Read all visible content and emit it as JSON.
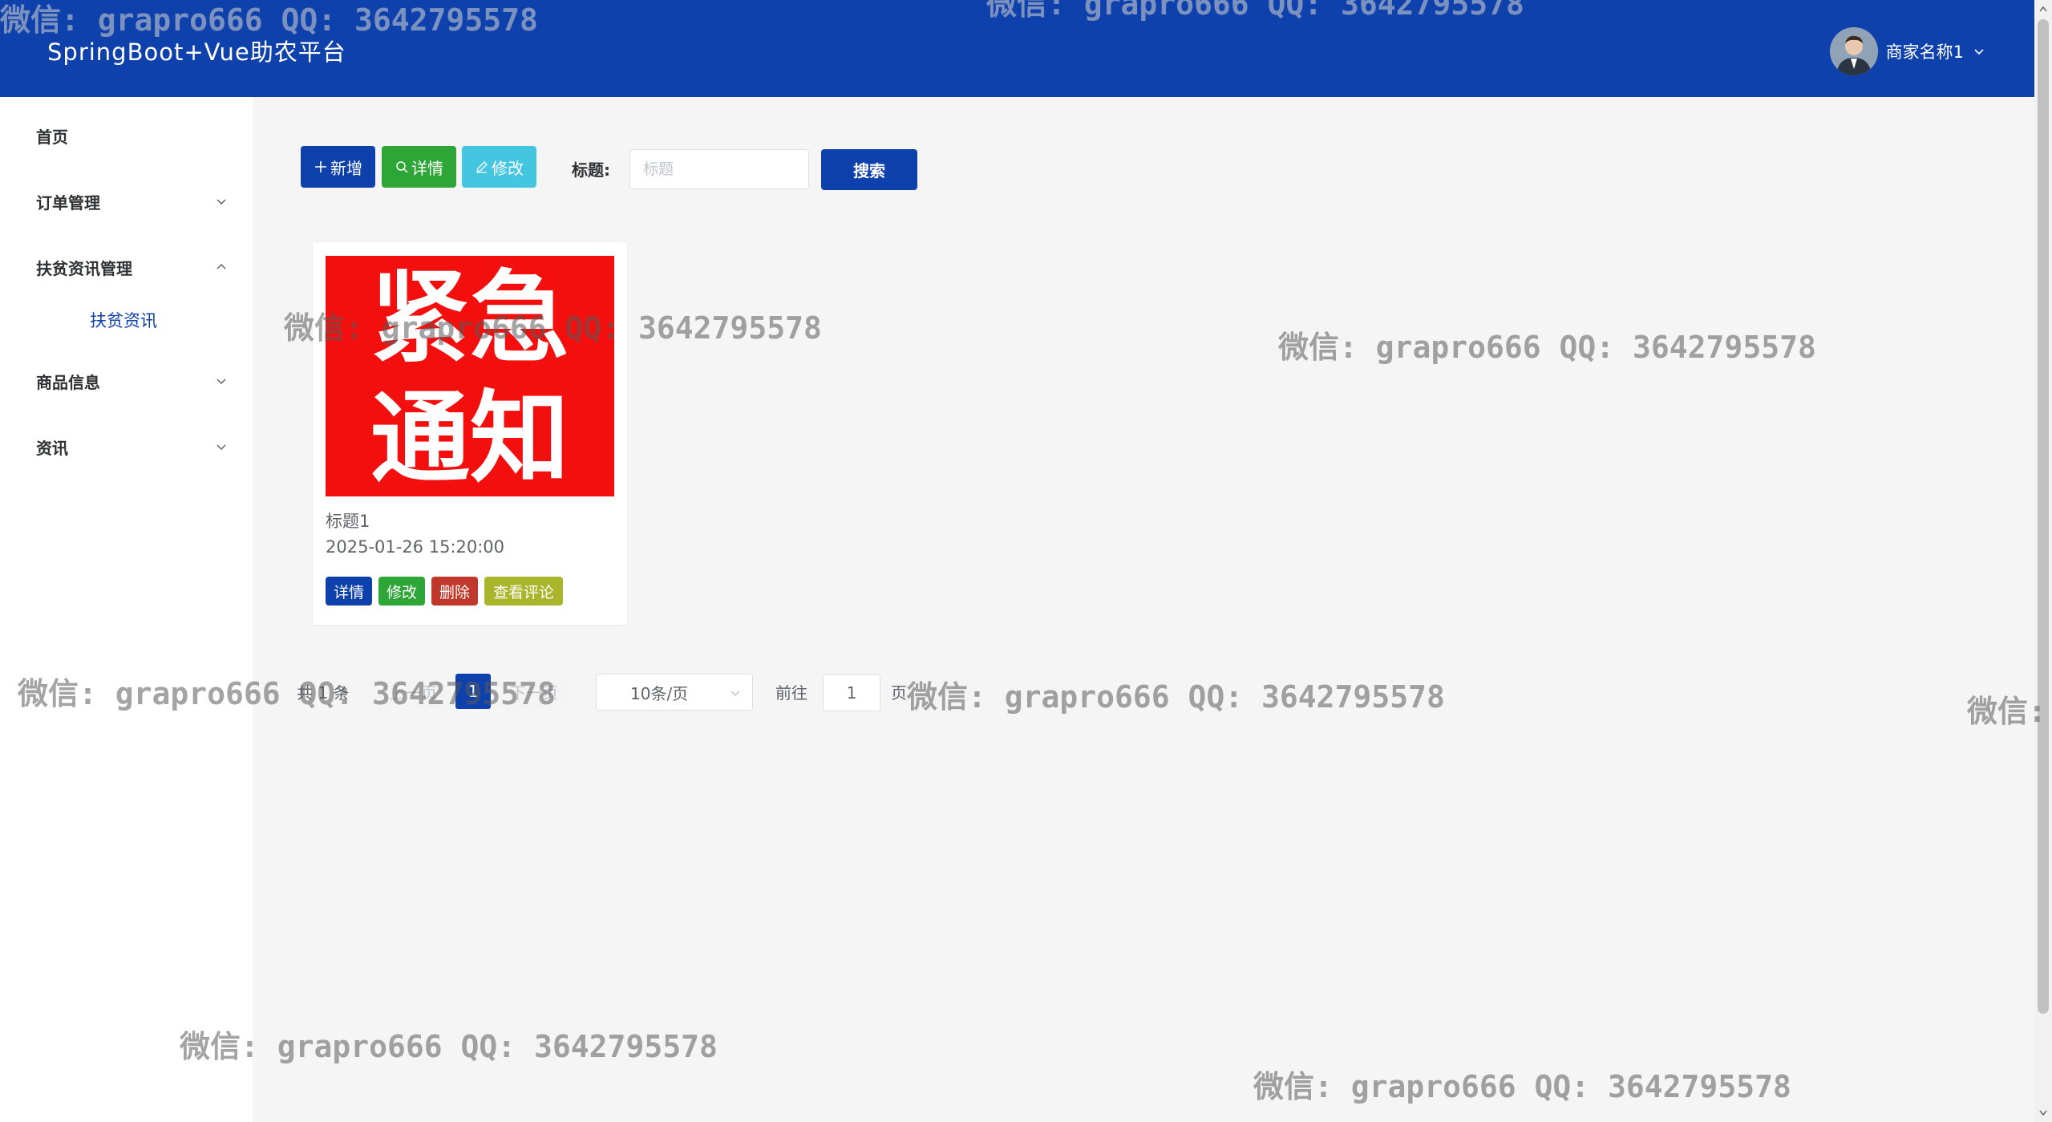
{
  "header": {
    "app_title": "SpringBoot+Vue助农平台",
    "user_name": "商家名称1",
    "brand_color": "#0f41ac"
  },
  "sidebar": {
    "items": [
      {
        "label": "首页",
        "icon": "none",
        "expanded": false
      },
      {
        "label": "订单管理",
        "icon": "chevron-down-icon",
        "expanded": false
      },
      {
        "label": "扶贫资讯管理",
        "icon": "chevron-up-icon",
        "expanded": true,
        "children": [
          {
            "label": "扶贫资讯",
            "active": true
          }
        ]
      },
      {
        "label": "商品信息",
        "icon": "chevron-down-icon",
        "expanded": false
      },
      {
        "label": "资讯",
        "icon": "chevron-down-icon",
        "expanded": false
      }
    ]
  },
  "toolbar": {
    "add_label": "新增",
    "detail_label": "详情",
    "edit_label": "修改",
    "filter_label": "标题:",
    "filter_placeholder": "标题",
    "filter_value": "",
    "search_label": "搜索"
  },
  "cards": [
    {
      "image_text": [
        "紧急",
        "通知"
      ],
      "title": "标题1",
      "date": "2025-01-26 15:20:00",
      "buttons": {
        "detail": "详情",
        "edit": "修改",
        "delete": "删除",
        "comments": "查看评论"
      }
    }
  ],
  "pagination": {
    "total_text": "共 1 条",
    "prev_label": "上一页",
    "current_page": "1",
    "next_label": "下一页",
    "page_size_label": "10条/页",
    "goto_label": "前往",
    "goto_value": "1",
    "goto_suffix": "页"
  },
  "watermark_text": "微信: grapro666 QQ: 3642795578",
  "watermark_partial": "微信:"
}
